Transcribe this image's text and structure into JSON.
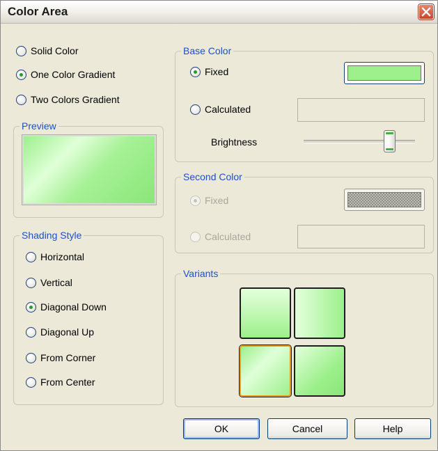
{
  "window": {
    "title": "Color Area"
  },
  "fill_mode": {
    "options": [
      {
        "label": "Solid Color",
        "checked": false
      },
      {
        "label": "One Color Gradient",
        "checked": true
      },
      {
        "label": "Two Colors Gradient",
        "checked": false
      }
    ]
  },
  "preview": {
    "label": "Preview",
    "color": "#9df08c"
  },
  "shading_style": {
    "label": "Shading Style",
    "options": [
      {
        "label": "Horizontal",
        "checked": false
      },
      {
        "label": "Vertical",
        "checked": false
      },
      {
        "label": "Diagonal Down",
        "checked": true
      },
      {
        "label": "Diagonal Up",
        "checked": false
      },
      {
        "label": "From Corner",
        "checked": false
      },
      {
        "label": "From Center",
        "checked": false
      }
    ]
  },
  "base_color": {
    "label": "Base Color",
    "fixed_label": "Fixed",
    "calculated_label": "Calculated",
    "brightness_label": "Brightness",
    "brightness_fraction": 0.76,
    "fixed_color": "#9df08c"
  },
  "second_color": {
    "label": "Second Color",
    "fixed_label": "Fixed",
    "calculated_label": "Calculated"
  },
  "variants": {
    "label": "Variants",
    "selected_index": 2
  },
  "buttons": {
    "ok": "OK",
    "cancel": "Cancel",
    "help": "Help"
  },
  "colors": {
    "accent": "#1f4fc8",
    "selection": "#e69a1c",
    "green": "#9df08c"
  }
}
